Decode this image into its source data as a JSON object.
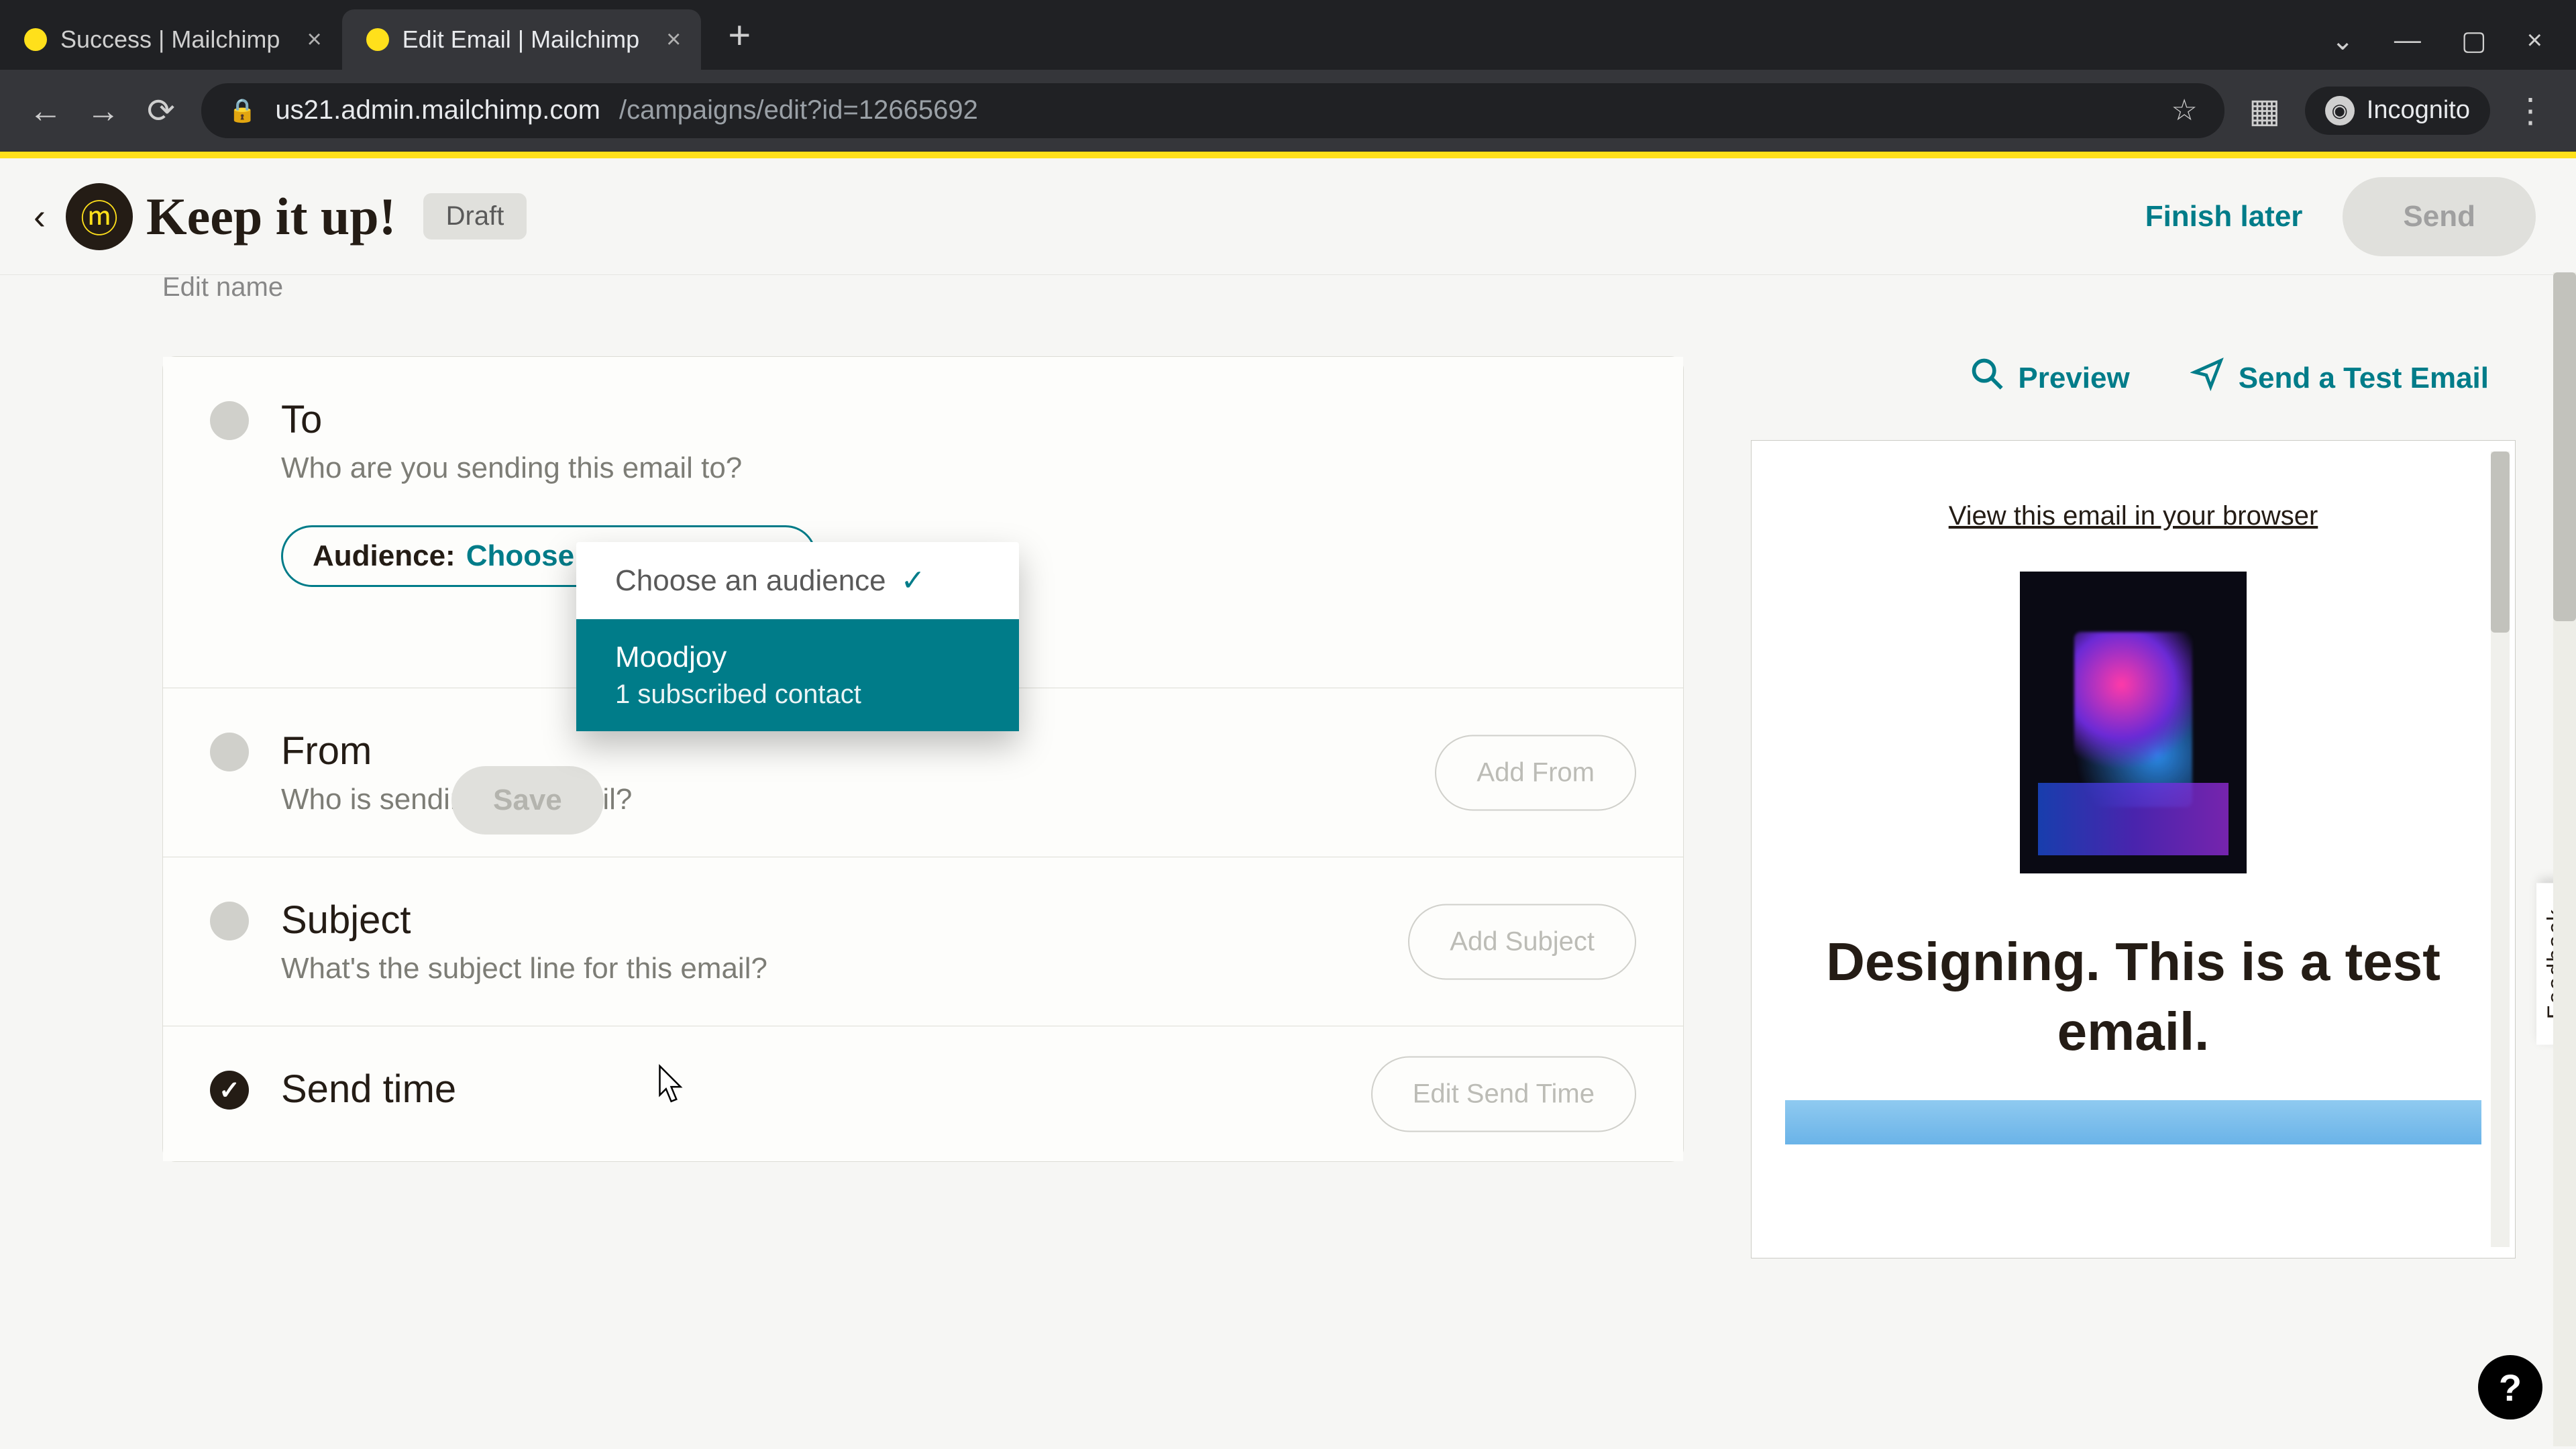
{
  "browser": {
    "tabs": [
      {
        "title": "Success | Mailchimp"
      },
      {
        "title": "Edit Email | Mailchimp"
      }
    ],
    "url_domain": "us21.admin.mailchimp.com",
    "url_path": "/campaigns/edit?id=12665692",
    "incognito_label": "Incognito"
  },
  "header": {
    "campaign_name": "Keep it up!",
    "status_badge": "Draft",
    "finish_later": "Finish later",
    "send": "Send",
    "edit_name": "Edit name"
  },
  "to": {
    "title": "To",
    "subtitle": "Who are you sending this email to?",
    "audience_label": "Audience:",
    "audience_value": "Choose an audience",
    "save": "Save",
    "dropdown": {
      "placeholder": "Choose an audience",
      "option_name": "Moodjoy",
      "option_sub": "1 subscribed contact"
    }
  },
  "from": {
    "title": "From",
    "subtitle": "Who is sending this email?",
    "action": "Add From"
  },
  "subject": {
    "title": "Subject",
    "subtitle": "What's the subject line for this email?",
    "action": "Add Subject"
  },
  "sendtime": {
    "title": "Send time",
    "action": "Edit Send Time"
  },
  "right": {
    "preview": "Preview",
    "test_email": "Send a Test Email",
    "view_browser": "View this email in your browser",
    "email_heading": "Designing. This is a test email."
  },
  "feedback": "Feedback",
  "help": "?"
}
